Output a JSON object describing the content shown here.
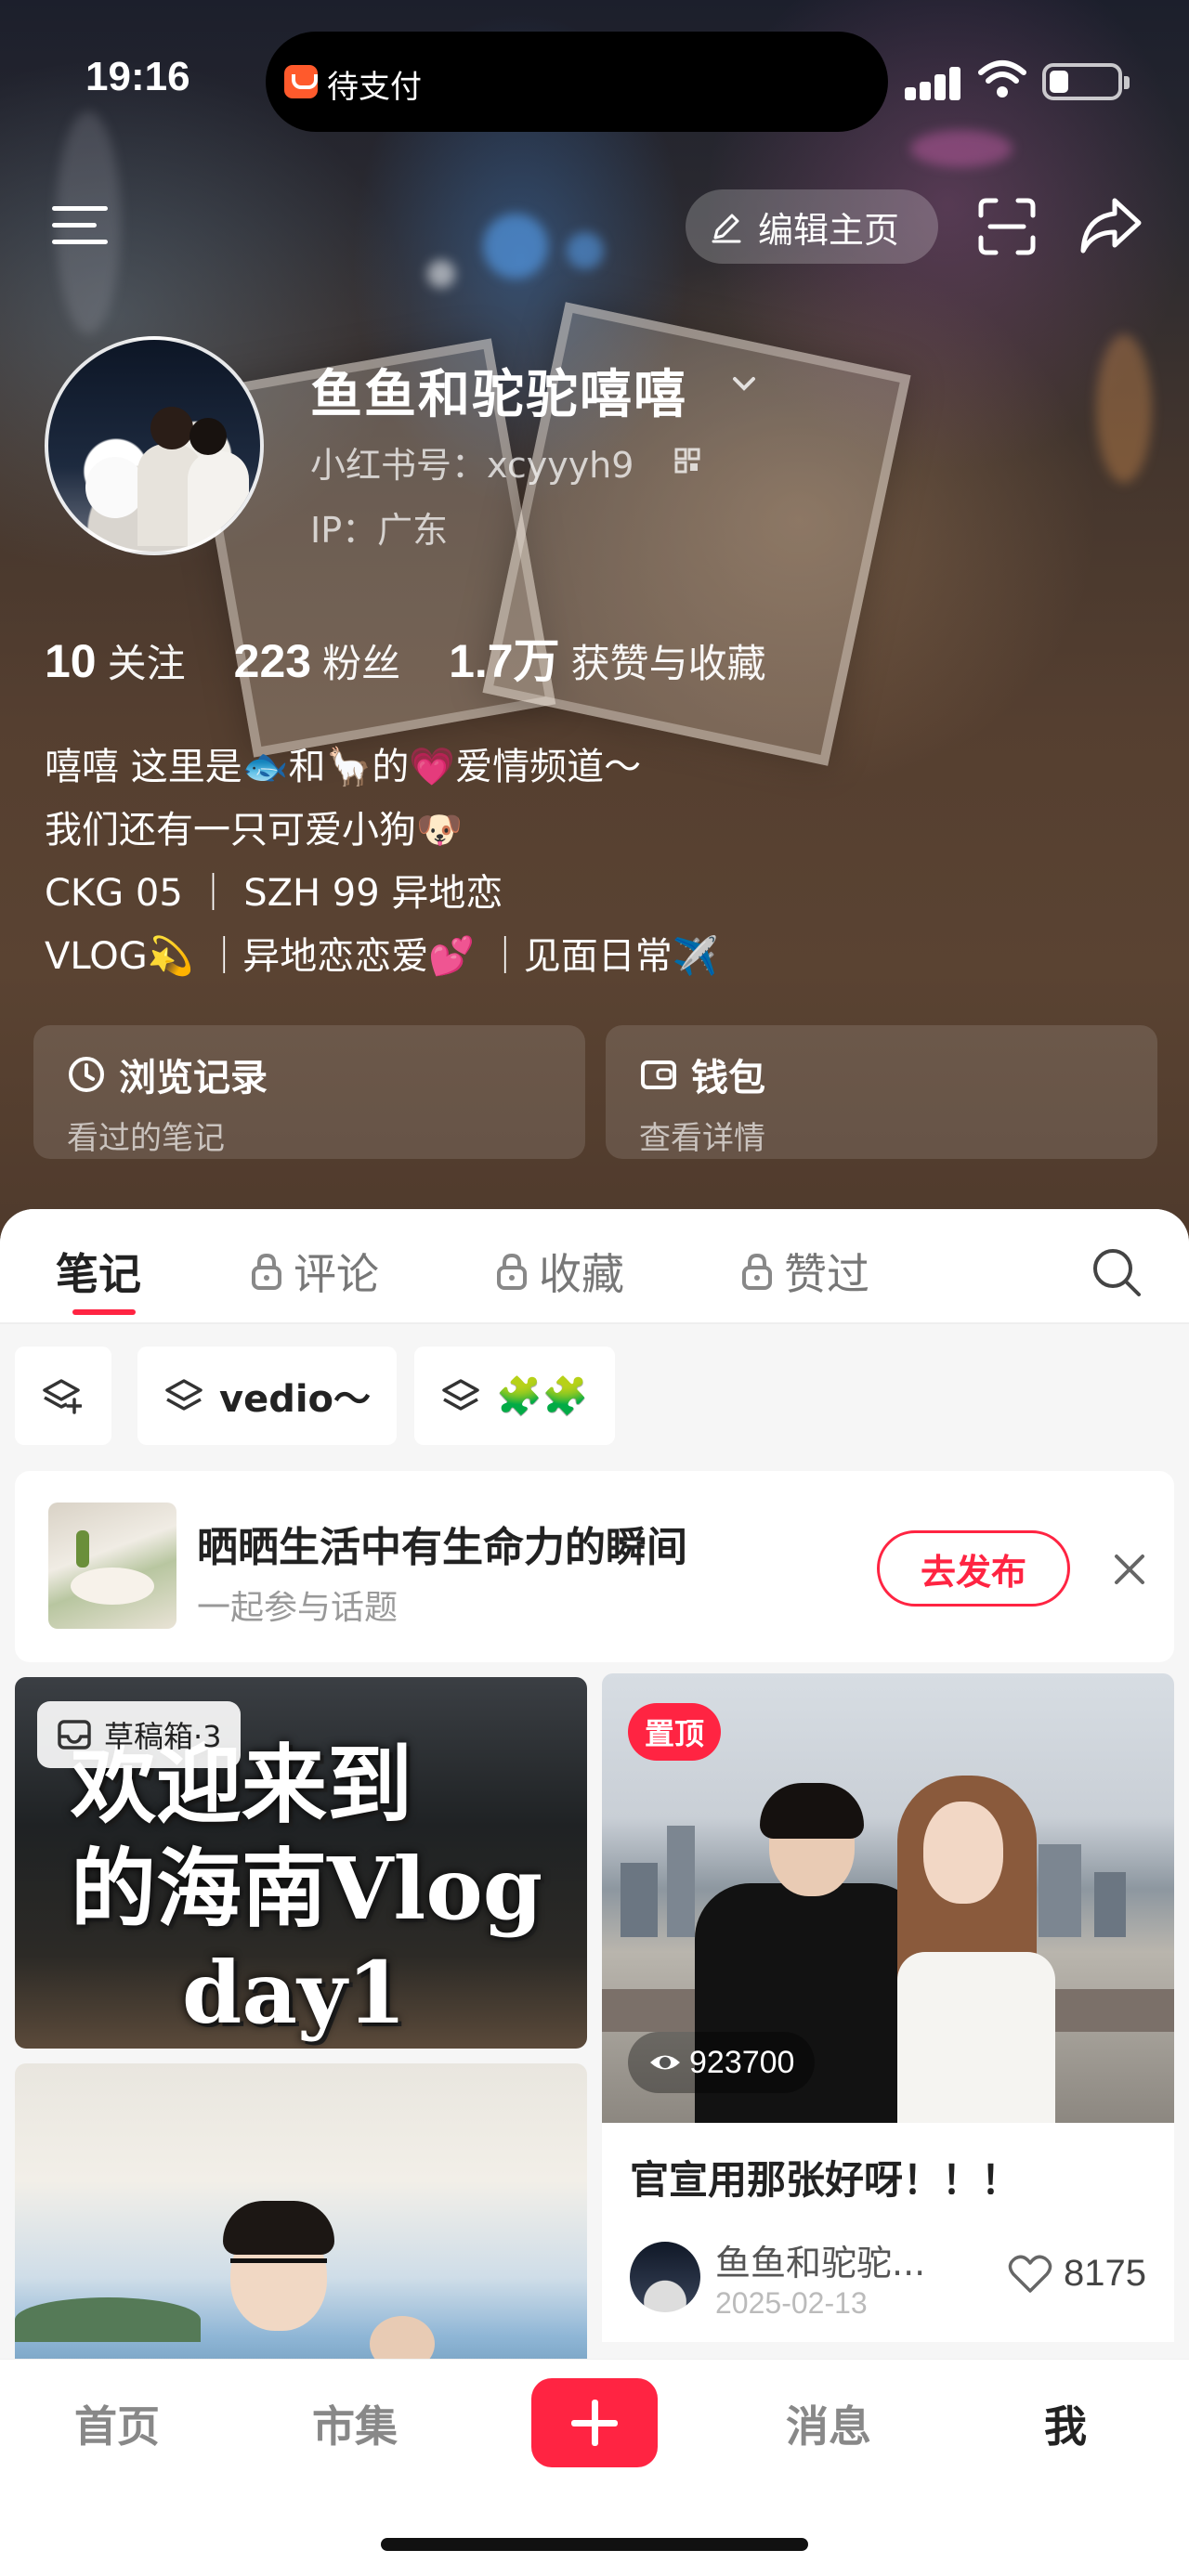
{
  "status_bar": {
    "time": "19:16",
    "pending_payment": "待支付",
    "icons": [
      "signal-icon",
      "wifi-icon",
      "battery-icon"
    ]
  },
  "header": {
    "edit_profile": "编辑主页",
    "icons": [
      "menu-icon",
      "pencil-icon",
      "scan-icon",
      "share-icon"
    ]
  },
  "profile": {
    "nickname": "鱼鱼和驼驼嘻嘻",
    "user_id": "小红书号：xcyyyh9",
    "ip": "IP：广东",
    "stats": [
      {
        "num": "10",
        "label": "关注"
      },
      {
        "num": "223",
        "label": "粉丝"
      },
      {
        "num": "1.7万",
        "label": "获赞与收藏"
      }
    ],
    "bio": [
      "嘻嘻 这里是🐟和🦙的💗爱情频道～",
      "我们还有一只可爱小狗🐶",
      "CKG 05 ｜ SZH 99 异地恋",
      "VLOG💫 ｜异地恋恋爱💕 ｜见面日常✈️"
    ],
    "quick_cards": [
      {
        "title": "浏览记录",
        "subtitle": "看过的笔记",
        "icon": "clock-icon"
      },
      {
        "title": "钱包",
        "subtitle": "查看详情",
        "icon": "wallet-icon"
      }
    ]
  },
  "tabs": {
    "items": [
      "笔记",
      "评论",
      "收藏",
      "赞过"
    ],
    "active": "笔记",
    "locked": [
      "评论",
      "收藏",
      "赞过"
    ]
  },
  "collections": {
    "chip_vedio": "vedio～",
    "chip_puzzle": "🧩🧩"
  },
  "topic": {
    "title": "晒晒生活中有生命力的瞬间",
    "subtitle": "一起参与话题",
    "post_button": "去发布"
  },
  "feed": {
    "drafts": "草稿箱·3",
    "vlog_cover_lines": [
      "欢迎来到",
      "的海南Vlog",
      "day1"
    ],
    "pinned_note": {
      "pin_label": "置顶",
      "views": "923700",
      "title": "官宣用那张好呀！！！",
      "author": "鱼鱼和驼驼...",
      "date": "2025-02-13",
      "likes": "8175"
    }
  },
  "bottom_nav": {
    "items": [
      "首页",
      "市集",
      "消息",
      "我"
    ],
    "active": "我"
  },
  "colors": {
    "accent": "#ff2442",
    "hero_background": "#553f30"
  }
}
